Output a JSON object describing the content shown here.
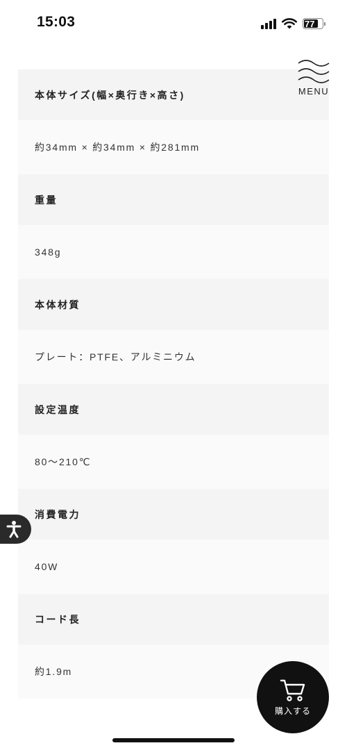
{
  "status_bar": {
    "time": "15:03",
    "battery_level": "77",
    "battery_percent": 77
  },
  "menu": {
    "label": "MENU"
  },
  "specs": [
    {
      "label": "本体サイズ(幅×奥行き×高さ)",
      "value": "約34mm × 約34mm × 約281mm"
    },
    {
      "label": "重量",
      "value": "348g"
    },
    {
      "label": "本体材質",
      "value": "プレート：PTFE、アルミニウム"
    },
    {
      "label": "設定温度",
      "value": "80〜210℃"
    },
    {
      "label": "消費電力",
      "value": "40W"
    },
    {
      "label": "コード長",
      "value": "約1.9m"
    }
  ],
  "cart": {
    "label": "購入する",
    "icon": "cart-icon"
  },
  "accessibility": {
    "icon": "accessibility-icon"
  },
  "colors": {
    "label_background": "#f4f4f4",
    "value_background": "#fafafa",
    "dark": "#111111"
  }
}
